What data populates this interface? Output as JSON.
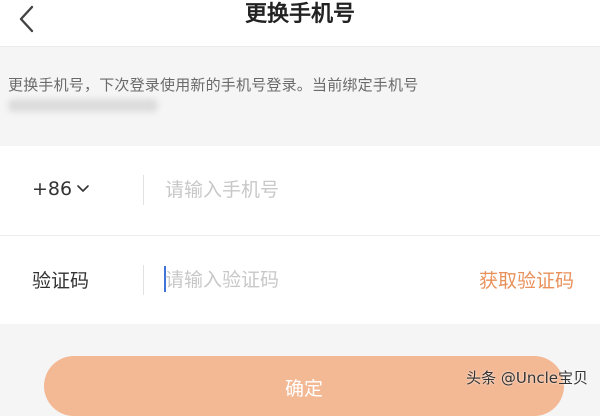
{
  "header": {
    "title": "更换手机号",
    "back_icon": "chevron-left-icon"
  },
  "description": {
    "text": "更换手机号，下次登录使用新的手机号登录。当前绑定手机号"
  },
  "form": {
    "phone_row": {
      "country_code": "+86",
      "chevron_icon": "chevron-down-icon",
      "placeholder": "请输入手机号"
    },
    "code_row": {
      "label": "验证码",
      "placeholder": "请输入验证码",
      "get_code_label": "获取验证码"
    }
  },
  "confirm": {
    "label": "确定"
  },
  "watermark": {
    "text": "头条 @Uncle宝贝"
  },
  "colors": {
    "accent": "#e9915a",
    "button_bg": "#f3b894",
    "caret": "#3f73d8"
  }
}
